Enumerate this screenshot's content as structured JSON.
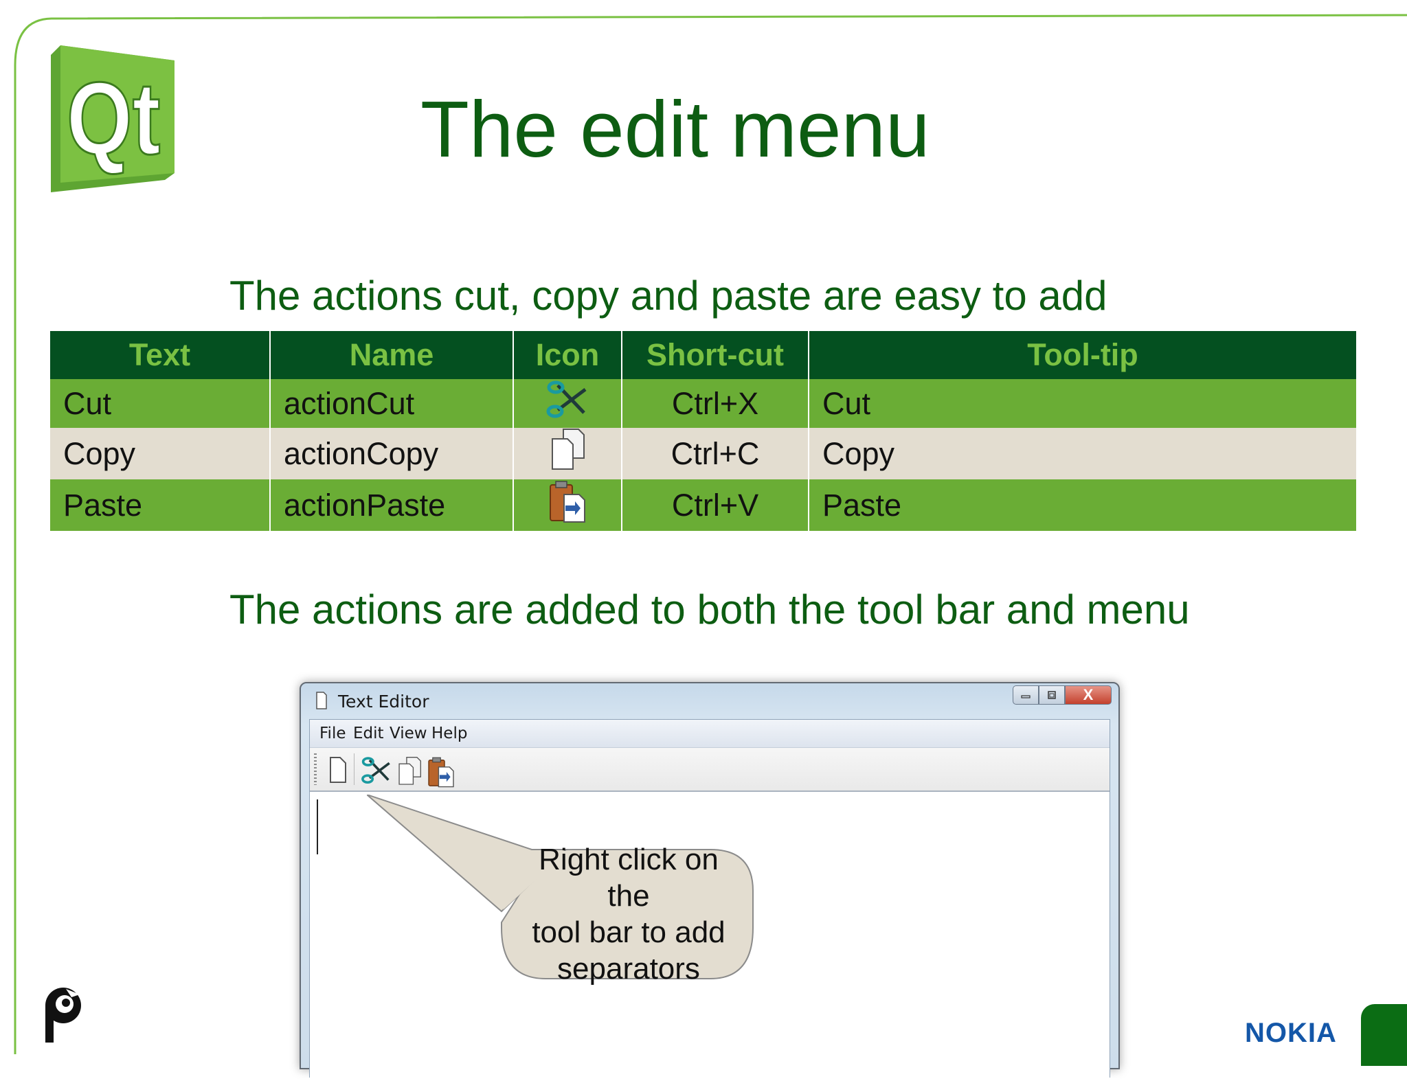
{
  "slide": {
    "title": "The edit menu",
    "subtitle_1": "The actions cut, copy and paste are easy to add",
    "subtitle_2": "The actions are added to both the tool bar and menu",
    "footer_brand": "NOKIA",
    "logo_text": "Qt"
  },
  "table": {
    "headers": [
      "Text",
      "Name",
      "Icon",
      "Short-cut",
      "Tool-tip"
    ],
    "rows": [
      {
        "text": "Cut",
        "name": "actionCut",
        "icon": "scissors-icon",
        "shortcut": "Ctrl+X",
        "tooltip": "Cut"
      },
      {
        "text": "Copy",
        "name": "actionCopy",
        "icon": "copy-icon",
        "shortcut": "Ctrl+C",
        "tooltip": "Copy"
      },
      {
        "text": "Paste",
        "name": "actionPaste",
        "icon": "paste-icon",
        "shortcut": "Ctrl+V",
        "tooltip": "Paste"
      }
    ]
  },
  "window": {
    "title": "Text Editor",
    "menus": [
      "File",
      "Edit",
      "View",
      "Help"
    ],
    "toolbar_icons": [
      "new-file-icon",
      "scissors-icon",
      "copy-icon",
      "paste-icon"
    ],
    "buttons": {
      "close": "X"
    }
  },
  "callout": {
    "lines": [
      "Right click on",
      "the",
      "tool bar to add",
      "separators"
    ]
  },
  "colors": {
    "title_green": "#0d5d12",
    "header_bg": "#045020",
    "header_text": "#7ac143",
    "row_green": "#6aad35",
    "row_beige": "#e3ddd0",
    "frame_green": "#7ac143",
    "nokia_blue": "#1457a8"
  }
}
